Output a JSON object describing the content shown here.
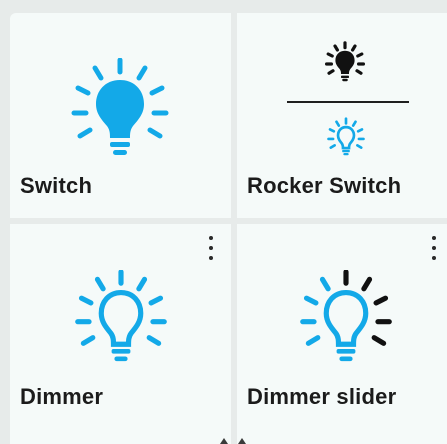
{
  "colors": {
    "accent": "#13a9e8",
    "dark": "#111111",
    "tile_bg": "#f5faf9",
    "page_bg": "#e7ebea"
  },
  "tiles": [
    {
      "label": "Switch",
      "icon": "lightbulb-filled-icon",
      "has_menu": false
    },
    {
      "label": "Rocker Switch",
      "icon": "rocker-switch-icon",
      "has_menu": false
    },
    {
      "label": "Dimmer",
      "icon": "lightbulb-outline-icon",
      "has_menu": true
    },
    {
      "label": "Dimmer slider",
      "icon": "lightbulb-dimmer-slider-icon",
      "has_menu": true
    }
  ]
}
